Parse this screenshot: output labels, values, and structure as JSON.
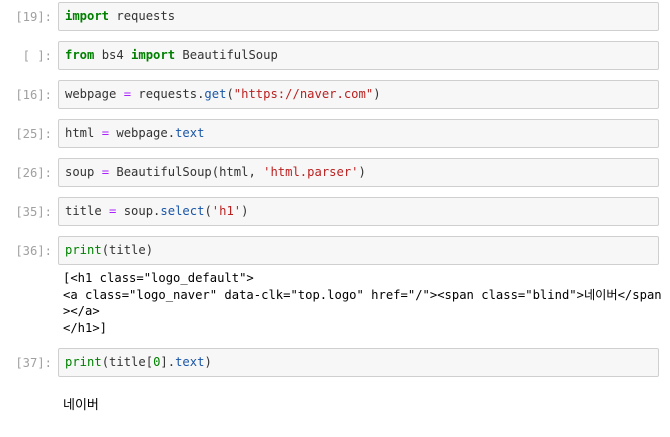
{
  "cells": [
    {
      "prompt": "[19]:",
      "code": [
        "import",
        " requests"
      ]
    },
    {
      "prompt": "[ ]:",
      "code": [
        "from",
        " bs4 ",
        "import",
        " BeautifulSoup"
      ]
    },
    {
      "prompt": "[16]:",
      "code": [
        "webpage ",
        "=",
        " requests.",
        "get",
        "(",
        "\"https://naver.com\"",
        ")"
      ]
    },
    {
      "prompt": "[25]:",
      "code": [
        "html ",
        "=",
        " webpage.",
        "text"
      ]
    },
    {
      "prompt": "[26]:",
      "code": [
        "soup ",
        "=",
        " BeautifulSoup(html, ",
        "'html.parser'",
        ")"
      ]
    },
    {
      "prompt": "[35]:",
      "code": [
        "title ",
        "=",
        " soup.",
        "select",
        "(",
        "'h1'",
        ")"
      ]
    },
    {
      "prompt": "[36]:",
      "code": [
        "print",
        "(title)"
      ],
      "output": "[<h1 class=\"logo_default\">\n<a class=\"logo_naver\" data-clk=\"top.logo\" href=\"/\"><span class=\"blind\">네이버</span\n></a>\n</h1>]"
    },
    {
      "prompt": "[37]:",
      "code": [
        "print",
        "(title[",
        "0",
        "].",
        "text",
        ")"
      ],
      "output": "네이버"
    }
  ]
}
